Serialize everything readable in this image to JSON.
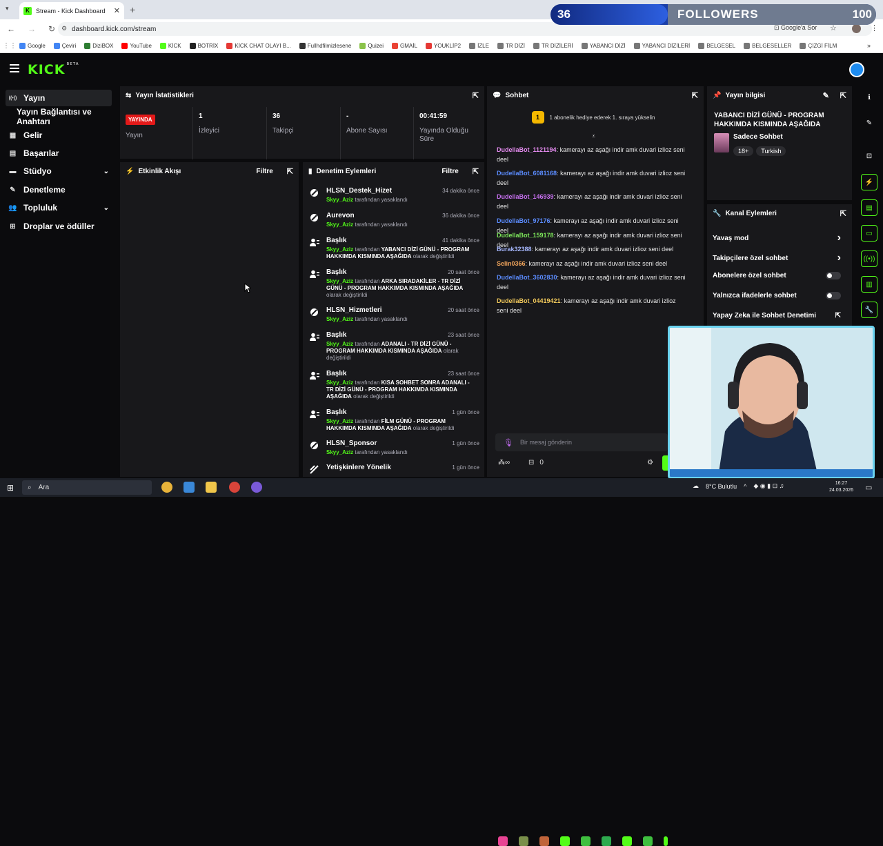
{
  "browser": {
    "tab_title": "Stream - Kick Dashboard",
    "url": "dashboard.kick.com/stream",
    "google_sor": "Google'a Sor",
    "bookmarks": [
      {
        "label": "Google",
        "color": "#4285f4"
      },
      {
        "label": "Çeviri",
        "color": "#4285f4"
      },
      {
        "label": "DiziBOX",
        "color": "#2e7d32"
      },
      {
        "label": "YouTube",
        "color": "#ff0000"
      },
      {
        "label": "KİCK",
        "color": "#53fc18"
      },
      {
        "label": "BOTRİX",
        "color": "#222222"
      },
      {
        "label": "KİCK CHAT OLAYI B...",
        "color": "#e53935"
      },
      {
        "label": "Fullhdfilmizlesene",
        "color": "#333333"
      },
      {
        "label": "Quizei",
        "color": "#8bc34a"
      },
      {
        "label": "GMAİL",
        "color": "#ea4335"
      },
      {
        "label": "YOUKLİP2",
        "color": "#e53935"
      },
      {
        "label": "İZLE",
        "color": "#777777"
      },
      {
        "label": "TR DİZİ",
        "color": "#777777"
      },
      {
        "label": "TR DİZİLERİ",
        "color": "#777777"
      },
      {
        "label": "YABANCI DİZİ",
        "color": "#777777"
      },
      {
        "label": "YABANCI DİZİLERİ",
        "color": "#777777"
      },
      {
        "label": "BELGESEL",
        "color": "#777777"
      },
      {
        "label": "BELGESELLER",
        "color": "#777777"
      },
      {
        "label": "ÇİZGİ FİLM",
        "color": "#777777"
      }
    ]
  },
  "overlay": {
    "current": "36",
    "label": "FOLLOWERS",
    "goal": "100",
    "progress": 0.36
  },
  "header": {
    "logo": "KICK",
    "logo_sup": "BETA"
  },
  "sidebar": {
    "items": [
      {
        "label": "Yayın",
        "icon": "broadcast-icon",
        "glyph": "((•))",
        "active": true
      },
      {
        "label": "Yayın Bağlantısı ve Anahtarı",
        "icon": "none",
        "glyph": ""
      },
      {
        "label": "Gelir",
        "icon": "revenue-icon",
        "glyph": "▦"
      },
      {
        "label": "Başarılar",
        "icon": "achievements-icon",
        "glyph": "▤"
      },
      {
        "label": "Stüdyo",
        "icon": "studio-icon",
        "glyph": "▬",
        "chevron": true
      },
      {
        "label": "Denetleme",
        "icon": "wrench-icon",
        "glyph": "✎"
      },
      {
        "label": "Topluluk",
        "icon": "community-icon",
        "glyph": "👥",
        "chevron": true
      },
      {
        "label": "Droplar ve ödüller",
        "icon": "gift-icon",
        "glyph": "⊞"
      }
    ]
  },
  "stats": {
    "title": "Yayın İstatistikleri",
    "live_badge": "YAYINDA",
    "items": [
      {
        "value": "",
        "label": "Yayın"
      },
      {
        "value": "1",
        "label": "İzleyici"
      },
      {
        "value": "36",
        "label": "Takipçi"
      },
      {
        "value": "-",
        "label": "Abone Sayısı"
      },
      {
        "value": "00:41:59",
        "label": "Yayında Olduğu Süre"
      }
    ]
  },
  "activity": {
    "title": "Etkinlik Akışı",
    "filter": "Filtre"
  },
  "moderation": {
    "title": "Denetim Eylemleri",
    "filter": "Filtre",
    "items": [
      {
        "kind": "ban",
        "name": "HLSN_Destek_Hizet",
        "time": "34 dakika önce",
        "user": "Skyy_Aziz",
        "mid": "tarafından yasaklandı",
        "target": "",
        "tail": ""
      },
      {
        "kind": "ban",
        "name": "Aurevon",
        "time": "36 dakika önce",
        "user": "Skyy_Aziz",
        "mid": "tarafından yasaklandı",
        "target": "",
        "tail": ""
      },
      {
        "kind": "title",
        "name": "Başlık",
        "time": "41 dakika önce",
        "user": "Skyy_Aziz",
        "mid": "tarafından",
        "target": "YABANCI DİZİ GÜNÜ - PROGRAM HAKKIMDA KISMINDA AŞAĞIDA",
        "tail": "olarak değiştirildi"
      },
      {
        "kind": "title",
        "name": "Başlık",
        "time": "20 saat önce",
        "user": "Skyy_Aziz",
        "mid": "tarafından",
        "target": "ARKA SIRADAKİLER - TR DİZİ GÜNÜ - PROGRAM HAKKIMDA KISMINDA AŞAĞIDA",
        "tail": "olarak değiştirildi"
      },
      {
        "kind": "ban",
        "name": "HLSN_Hizmetleri",
        "time": "20 saat önce",
        "user": "Skyy_Aziz",
        "mid": "tarafından yasaklandı",
        "target": "",
        "tail": ""
      },
      {
        "kind": "title",
        "name": "Başlık",
        "time": "23 saat önce",
        "user": "Skyy_Aziz",
        "mid": "tarafından",
        "target": "ADANALI - TR DİZİ GÜNÜ - PROGRAM HAKKIMDA KISMINDA AŞAĞIDA",
        "tail": "olarak değiştirildi"
      },
      {
        "kind": "title",
        "name": "Başlık",
        "time": "23 saat önce",
        "user": "Skyy_Aziz",
        "mid": "tarafından",
        "target": "KISA SOHBET SONRA ADANALI - TR DİZİ GÜNÜ - PROGRAM HAKKIMDA KISMINDA AŞAĞIDA",
        "tail": "olarak değiştirildi"
      },
      {
        "kind": "title",
        "name": "Başlık",
        "time": "1 gün önce",
        "user": "Skyy_Aziz",
        "mid": "tarafından",
        "target": "FİLM GÜNÜ - PROGRAM HAKKIMDA KISMINDA AŞAĞIDA",
        "tail": "olarak değiştirildi"
      },
      {
        "kind": "ban",
        "name": "HLSN_Sponsor",
        "time": "1 gün önce",
        "user": "Skyy_Aziz",
        "mid": "tarafından yasaklandı",
        "target": "",
        "tail": ""
      },
      {
        "kind": "mature",
        "name": "Yetişkinlere Yönelik",
        "time": "1 gün önce",
        "user": "",
        "mid": "",
        "target": "",
        "tail": ""
      }
    ]
  },
  "chat": {
    "title": "Sohbet",
    "pinned_count": "1",
    "pinned_text": "1 abonelik hediye ederek 1. sıraya yükselin",
    "messages": [
      {
        "user": "DudellaBot_1121194",
        "color": "#e58cf0",
        "text": "kamerayı az aşağı indir amk duvari izlioz seni deel"
      },
      {
        "user": "DudellaBot_6081168",
        "color": "#5b8cff",
        "text": "kamerayı az aşağı indir amk duvari izlioz seni deel"
      },
      {
        "user": "DudellaBot_146939",
        "color": "#c770f0",
        "text": "kamerayı az aşağı indir amk duvari izlioz seni deel"
      },
      {
        "user": "DudellaBot_97176",
        "color": "#5b8cff",
        "text": "kamerayı az aşağı indir amk duvari izlioz seni deel"
      },
      {
        "user": "DudellaBot_159178",
        "color": "#7ee85b",
        "text": "kamerayı az aşağı indir amk duvari izlioz seni deel"
      },
      {
        "user": "Burak32388",
        "color": "#a7b8ff",
        "text": "kamerayı az aşağı indir amk duvari izlioz seni deel"
      },
      {
        "user": "Selin0366",
        "color": "#f0a45b",
        "text": "kamerayı az aşağı indir amk duvari izlioz seni deel"
      },
      {
        "user": "DudellaBot_3602830",
        "color": "#5b8cff",
        "text": "kamerayı az aşağı indir amk duvari izlioz seni deel"
      },
      {
        "user": "DudellaBot_04419421",
        "color": "#f0c85b",
        "text": "kamerayı az aşağı indir amk duvari izlioz seni deel"
      }
    ],
    "input_placeholder": "Bir mesaj gönderin",
    "points": "0"
  },
  "stream_info": {
    "title": "Yayın bilgisi",
    "stream_title": "YABANCI DİZİ GÜNÜ - PROGRAM HAKKIMDA KISMINDA AŞAĞIDA",
    "category": "Sadece Sohbet",
    "tags": [
      "18+",
      "Turkish"
    ]
  },
  "channel_actions": {
    "title": "Kanal Eylemleri",
    "items": [
      {
        "label": "Yavaş mod",
        "control": "chevron"
      },
      {
        "label": "Takipçilere özel sohbet",
        "control": "chevron"
      },
      {
        "label": "Abonelere özel sohbet",
        "control": "toggle"
      },
      {
        "label": "Yalnızca ifadelerle sohbet",
        "control": "toggle"
      },
      {
        "label": "Yapay Zeka ile Sohbet Denetimi",
        "control": "external"
      }
    ]
  },
  "taskbar": {
    "search": "Ara",
    "weather": "8°C  Bulutlu",
    "time": "16:27",
    "date": "24.03.2026"
  }
}
